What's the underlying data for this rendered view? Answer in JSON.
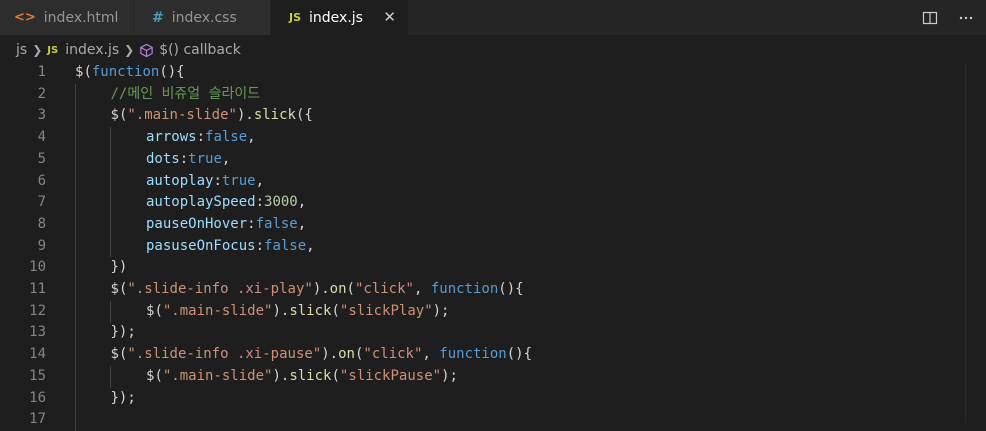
{
  "tabs": [
    {
      "label": "index.html",
      "icon": "html-file-icon"
    },
    {
      "label": "index.css",
      "icon": "css-file-icon",
      "glyph": "#"
    },
    {
      "label": "index.js",
      "icon": "js-file-icon",
      "glyph": "JS",
      "active": true
    }
  ],
  "breadcrumb": {
    "folder": "js",
    "file_glyph": "JS",
    "file": "index.js",
    "symbol": "$() callback"
  },
  "lines": [
    {
      "n": "1",
      "indent": 0,
      "tokens": [
        [
          "$",
          "punc"
        ],
        [
          "(",
          "punc"
        ],
        [
          "function",
          "kw"
        ],
        [
          "(){",
          "punc"
        ]
      ]
    },
    {
      "n": "2",
      "indent": 1,
      "tokens": [
        [
          "//메인 비쥬얼 슬라이드",
          "cmt"
        ]
      ]
    },
    {
      "n": "3",
      "indent": 1,
      "tokens": [
        [
          "$",
          "punc"
        ],
        [
          "(",
          "punc"
        ],
        [
          "\".main-slide\"",
          "str"
        ],
        [
          ").",
          "punc"
        ],
        [
          "slick",
          "fn"
        ],
        [
          "({",
          "punc"
        ]
      ]
    },
    {
      "n": "4",
      "indent": 2,
      "tokens": [
        [
          "arrows",
          "prop"
        ],
        [
          ":",
          "punc"
        ],
        [
          "false",
          "kw"
        ],
        [
          ",",
          "punc"
        ]
      ]
    },
    {
      "n": "5",
      "indent": 2,
      "tokens": [
        [
          "dots",
          "prop"
        ],
        [
          ":",
          "punc"
        ],
        [
          "true",
          "kw"
        ],
        [
          ",",
          "punc"
        ]
      ]
    },
    {
      "n": "6",
      "indent": 2,
      "tokens": [
        [
          "autoplay",
          "prop"
        ],
        [
          ":",
          "punc"
        ],
        [
          "true",
          "kw"
        ],
        [
          ",",
          "punc"
        ]
      ]
    },
    {
      "n": "7",
      "indent": 2,
      "tokens": [
        [
          "autoplaySpeed",
          "prop"
        ],
        [
          ":",
          "punc"
        ],
        [
          "3000",
          "num"
        ],
        [
          ",",
          "punc"
        ]
      ]
    },
    {
      "n": "8",
      "indent": 2,
      "tokens": [
        [
          "pauseOnHover",
          "prop"
        ],
        [
          ":",
          "punc"
        ],
        [
          "false",
          "kw"
        ],
        [
          ",",
          "punc"
        ]
      ]
    },
    {
      "n": "9",
      "indent": 2,
      "tokens": [
        [
          "pasuseOnFocus",
          "prop"
        ],
        [
          ":",
          "punc"
        ],
        [
          "false",
          "kw"
        ],
        [
          ",",
          "punc"
        ]
      ]
    },
    {
      "n": "10",
      "indent": 1,
      "tokens": [
        [
          "})",
          "punc"
        ]
      ]
    },
    {
      "n": "11",
      "indent": 1,
      "tokens": [
        [
          "$",
          "punc"
        ],
        [
          "(",
          "punc"
        ],
        [
          "\".slide-info .xi-play\"",
          "str"
        ],
        [
          ").",
          "punc"
        ],
        [
          "on",
          "fn"
        ],
        [
          "(",
          "punc"
        ],
        [
          "\"click\"",
          "str"
        ],
        [
          ", ",
          "punc"
        ],
        [
          "function",
          "kw"
        ],
        [
          "(){",
          "punc"
        ]
      ]
    },
    {
      "n": "12",
      "indent": 2,
      "tokens": [
        [
          "$",
          "punc"
        ],
        [
          "(",
          "punc"
        ],
        [
          "\".main-slide\"",
          "str"
        ],
        [
          ").",
          "punc"
        ],
        [
          "slick",
          "fn"
        ],
        [
          "(",
          "punc"
        ],
        [
          "\"slickPlay\"",
          "str"
        ],
        [
          ");",
          "punc"
        ]
      ]
    },
    {
      "n": "13",
      "indent": 1,
      "tokens": [
        [
          "});",
          "punc"
        ]
      ]
    },
    {
      "n": "14",
      "indent": 1,
      "tokens": [
        [
          "$",
          "punc"
        ],
        [
          "(",
          "punc"
        ],
        [
          "\".slide-info .xi-pause\"",
          "str"
        ],
        [
          ").",
          "punc"
        ],
        [
          "on",
          "fn"
        ],
        [
          "(",
          "punc"
        ],
        [
          "\"click\"",
          "str"
        ],
        [
          ", ",
          "punc"
        ],
        [
          "function",
          "kw"
        ],
        [
          "(){",
          "punc"
        ]
      ]
    },
    {
      "n": "15",
      "indent": 2,
      "tokens": [
        [
          "$",
          "punc"
        ],
        [
          "(",
          "punc"
        ],
        [
          "\".main-slide\"",
          "str"
        ],
        [
          ").",
          "punc"
        ],
        [
          "slick",
          "fn"
        ],
        [
          "(",
          "punc"
        ],
        [
          "\"slickPause\"",
          "str"
        ],
        [
          ");",
          "punc"
        ]
      ]
    },
    {
      "n": "16",
      "indent": 1,
      "tokens": [
        [
          "});",
          "punc"
        ]
      ]
    },
    {
      "n": "17",
      "indent": 0,
      "tokens": []
    }
  ]
}
